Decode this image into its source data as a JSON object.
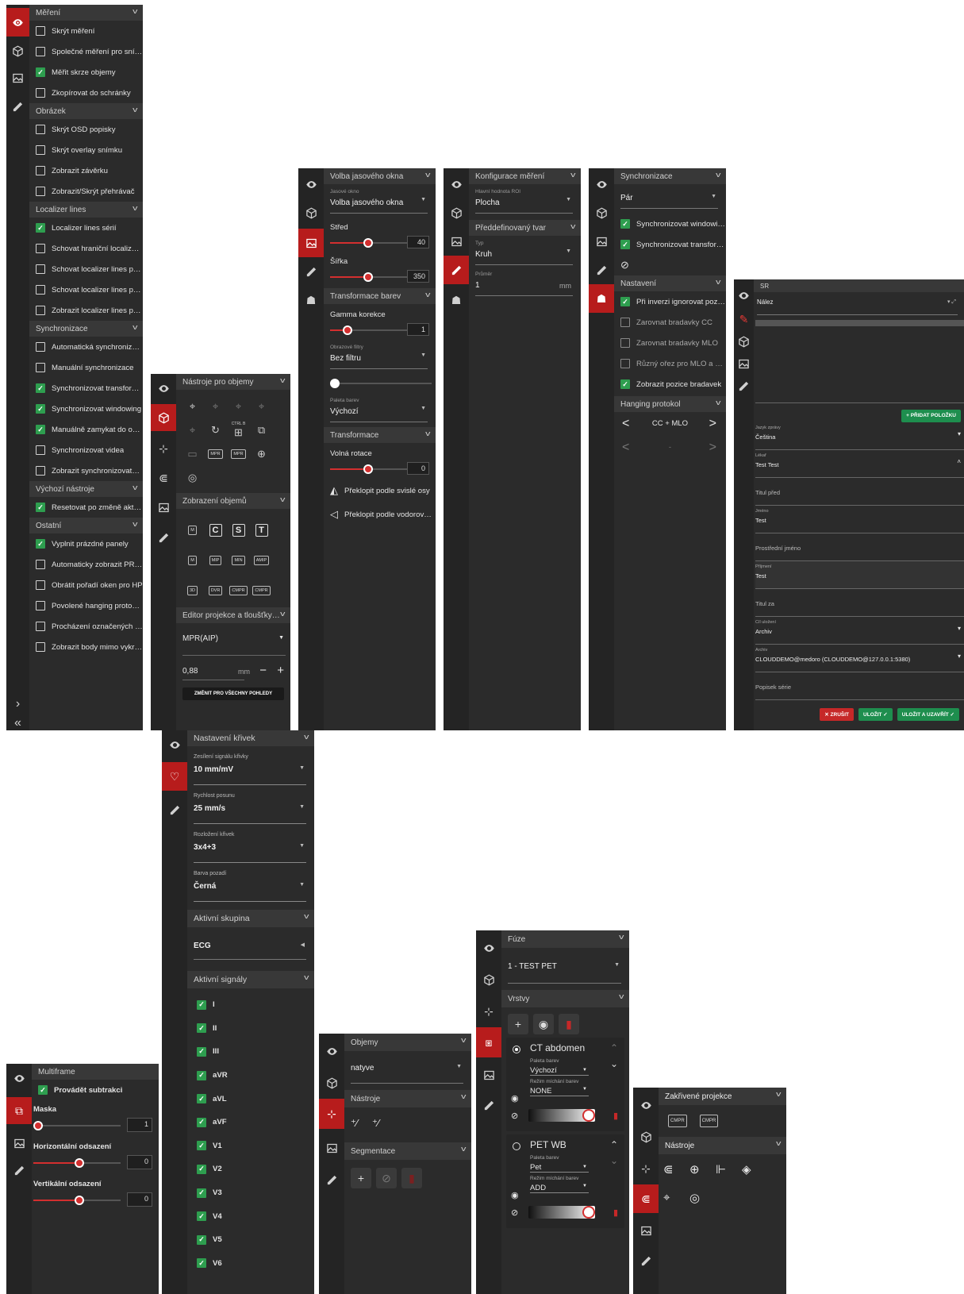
{
  "p1": {
    "sections": [
      {
        "title": "Měření",
        "items": [
          {
            "label": "Skrýt měření",
            "checked": false
          },
          {
            "label": "Společné měření pro sním…",
            "checked": false
          },
          {
            "label": "Měřit skrze objemy",
            "checked": true
          },
          {
            "label": "Zkopírovat do schránky",
            "checked": false
          }
        ]
      },
      {
        "title": "Obrázek",
        "items": [
          {
            "label": "Skrýt OSD popisky",
            "checked": false
          },
          {
            "label": "Skrýt overlay snímku",
            "checked": false
          },
          {
            "label": "Zobrazit závěrku",
            "checked": false
          },
          {
            "label": "Zobrazit/Skrýt přehrávač",
            "checked": false
          }
        ]
      },
      {
        "title": "Localizer lines",
        "items": [
          {
            "label": "Localizer lines sérií",
            "checked": true
          },
          {
            "label": "Schovat hraniční localizer …",
            "checked": false
          },
          {
            "label": "Schovat localizer lines pro…",
            "checked": false
          },
          {
            "label": "Schovat localizer lines pro…",
            "checked": false
          },
          {
            "label": "Zobrazit localizer lines pro…",
            "checked": false
          }
        ]
      },
      {
        "title": "Synchronizace",
        "items": [
          {
            "label": "Automatická synchroniza…",
            "checked": false
          },
          {
            "label": "Manuální synchronizace",
            "checked": false
          },
          {
            "label": "Synchronizovat transform…",
            "checked": true
          },
          {
            "label": "Synchronizovat windowing",
            "checked": true
          },
          {
            "label": "Manuálně zamykat do odd…",
            "checked": true
          },
          {
            "label": "Synchronizovat videa",
            "checked": false
          },
          {
            "label": "Zobrazit synchronizovatel…",
            "checked": false
          }
        ]
      },
      {
        "title": "Výchozí nástroje",
        "items": [
          {
            "label": "Resetovat po změně aktiv…",
            "checked": true
          }
        ]
      },
      {
        "title": "Ostatní",
        "items": [
          {
            "label": "Vyplnit prázdné panely",
            "checked": true
          },
          {
            "label": "Automaticky zobrazit PR p…",
            "checked": false
          },
          {
            "label": "Obrátit pořadí oken pro HP",
            "checked": false
          },
          {
            "label": "Povolené hanging protoko…",
            "checked": false
          },
          {
            "label": "Procházení označených s…",
            "checked": false
          },
          {
            "label": "Zobrazit body mimo vykre…",
            "checked": false
          }
        ]
      }
    ],
    "bottom_icons": [
      "›",
      "«"
    ]
  },
  "p2": {
    "title1": "Nástroje pro objemy",
    "title2": "Zobrazení objemů",
    "title3": "Editor projekce a tloušťky…",
    "ctrl_label": "CTRL B",
    "tool_boxes": [
      "MPR",
      "MPR",
      "MPR",
      "MPR"
    ],
    "view_boxes": [
      "M",
      "C",
      "S",
      "T",
      "M",
      "MIP",
      "MIN",
      "AMIP",
      "3D",
      "DVR",
      "CMPR",
      "CMPR"
    ],
    "select_value": "MPR(AIP)",
    "thickness": "0,88",
    "unit": "mm",
    "apply_btn": "ZMĚNIT PRO VŠECHNY POHLEDY"
  },
  "p3": {
    "sec1": "Volba jasového okna",
    "select1_label": "Jasové okno",
    "select1_value": "Volba jasového okna",
    "stred_label": "Střed",
    "stred_value": "40",
    "sirka_label": "Šířka",
    "sirka_value": "350",
    "sec2": "Transformace barev",
    "gamma_label": "Gamma korekce",
    "gamma_value": "1",
    "filter_label": "Obrazové filtry",
    "filter_value": "Bez filtru",
    "palette_label": "Paleta barev",
    "palette_value": "Výchozí",
    "sec3": "Transformace",
    "rot_label": "Volná rotace",
    "rot_value": "0",
    "flip_v": "Překlopit podle svislé osy",
    "flip_h": "Překlopit podle vodorovné…"
  },
  "p4": {
    "sec1": "Konfigurace měření",
    "roi_label": "Hlavní hodnota ROI",
    "roi_value": "Plocha",
    "sec2": "Předdefinovaný tvar",
    "type_label": "Typ",
    "type_value": "Kruh",
    "diam_label": "Průměr",
    "diam_value": "1",
    "diam_unit": "mm"
  },
  "p5": {
    "sec1": "Synchronizace",
    "pair_value": "Pár",
    "sync_items": [
      {
        "label": "Synchronizovat windowing",
        "checked": true
      },
      {
        "label": "Synchronizovat transform…",
        "checked": true
      }
    ],
    "sec2": "Nastavení",
    "set_items": [
      {
        "label": "Při inverzi ignorovat pozadí",
        "checked": true,
        "dim": false
      },
      {
        "label": "Zarovnat bradavky CC",
        "checked": false,
        "dim": true
      },
      {
        "label": "Zarovnat bradavky MLO",
        "checked": false,
        "dim": true
      },
      {
        "label": "Různý ořez pro MLO a CC",
        "checked": false,
        "dim": true
      },
      {
        "label": "Zobrazit pozice bradavek",
        "checked": true,
        "dim": false
      }
    ],
    "sec3": "Hanging protokol",
    "hp1": "CC + MLO",
    "hp2": "-"
  },
  "p6": {
    "sec1": "SR",
    "nalez": "Nález",
    "add_btn": "+ PŘIDAT POLOŽKU",
    "fields": [
      {
        "label": "Jazyk zprávy",
        "value": "Čeština",
        "arrow": "▾"
      },
      {
        "label": "Lékař",
        "value": "Test Test",
        "arrow": "˄"
      },
      {
        "label": "",
        "value": "Titul před",
        "arrow": ""
      },
      {
        "label": "Jméno",
        "value": "Test",
        "arrow": ""
      },
      {
        "label": "",
        "value": "Prostřední jméno",
        "arrow": ""
      },
      {
        "label": "Příjmení",
        "value": "Test",
        "arrow": ""
      },
      {
        "label": "",
        "value": "Titul za",
        "arrow": ""
      },
      {
        "label": "Cíl uložení",
        "value": "Archiv",
        "arrow": "▾"
      },
      {
        "label": "Archiv",
        "value": "CLOUDDEMO@medoro (CLOUDDEMO@127.0.0.1:5380)",
        "arrow": "▾"
      },
      {
        "label": "",
        "value": "Popisek série",
        "arrow": ""
      }
    ],
    "btn_cancel": "✕ ZRUŠIT",
    "btn_save": "ULOŽIT ✓",
    "btn_save_close": "ULOŽIT A UZAVŘÍT ✓"
  },
  "p7": {
    "sec1": "Multiframe",
    "subtract": "Provádět subtrakci",
    "mask_label": "Maska",
    "mask_value": "1",
    "h_label": "Horizontální odsazení",
    "h_value": "0",
    "v_label": "Vertikální odsazení",
    "v_value": "0"
  },
  "p8": {
    "sec1": "Nastavení křivek",
    "fields": [
      {
        "label": "Zesílení signálu křivky",
        "value": "10 mm/mV"
      },
      {
        "label": "Rychlost posunu",
        "value": "25 mm/s"
      },
      {
        "label": "Rozložení křivek",
        "value": "3x4+3"
      },
      {
        "label": "Barva pozadí",
        "value": "Černá"
      }
    ],
    "sec2": "Aktivní skupina",
    "group": "ECG",
    "sec3": "Aktivní signály",
    "signals": [
      "I",
      "II",
      "III",
      "aVR",
      "aVL",
      "aVF",
      "V1",
      "V2",
      "V3",
      "V4",
      "V5",
      "V6"
    ]
  },
  "p9": {
    "sec1": "Objemy",
    "select": "natyve",
    "sec2": "Nástroje",
    "sec3": "Segmentace"
  },
  "p10": {
    "sec1": "Fúze",
    "select": "1 - TEST PET",
    "sec2": "Vrstvy",
    "layers": [
      {
        "name": "CT abdomen",
        "palette_label": "Paleta barev",
        "palette": "Výchozí",
        "blend_label": "Režim míchání barev",
        "blend": "NONE",
        "selected": true
      },
      {
        "name": "PET WB",
        "palette_label": "Paleta barev",
        "palette": "Pet",
        "blend_label": "Režim míchání barev",
        "blend": "ADD",
        "selected": false
      }
    ]
  },
  "p11": {
    "sec1": "Zakřivené projekce",
    "sec2": "Nástroje",
    "boxes": [
      "CMPR",
      "CMPR"
    ]
  }
}
